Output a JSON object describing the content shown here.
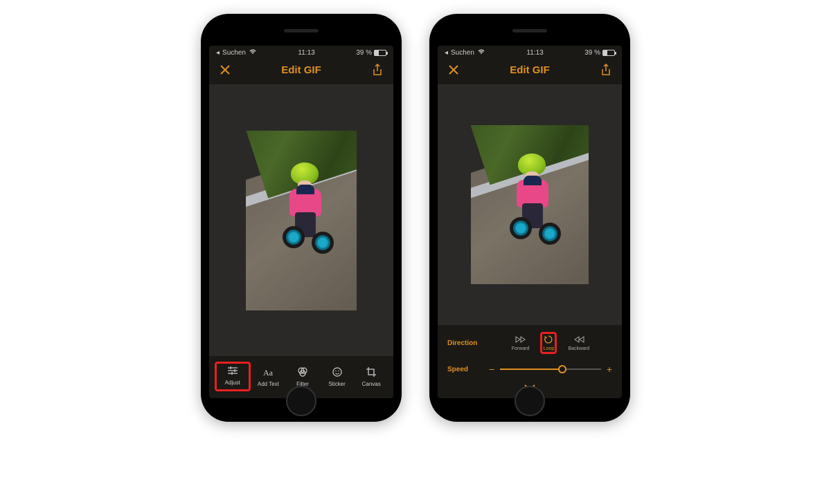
{
  "statusbar": {
    "back_label": "Suchen",
    "time": "11:13",
    "battery": "39 %"
  },
  "header": {
    "title": "Edit GIF"
  },
  "toolbar": {
    "adjust": "Adjust",
    "add_text": "Add Text",
    "filter": "Filter",
    "sticker": "Sticker",
    "canvas": "Canvas"
  },
  "controls": {
    "direction_label": "Direction",
    "speed_label": "Speed",
    "forward": "Forward",
    "loop": "Loop",
    "backward": "Backward",
    "minus": "−",
    "plus": "+"
  }
}
